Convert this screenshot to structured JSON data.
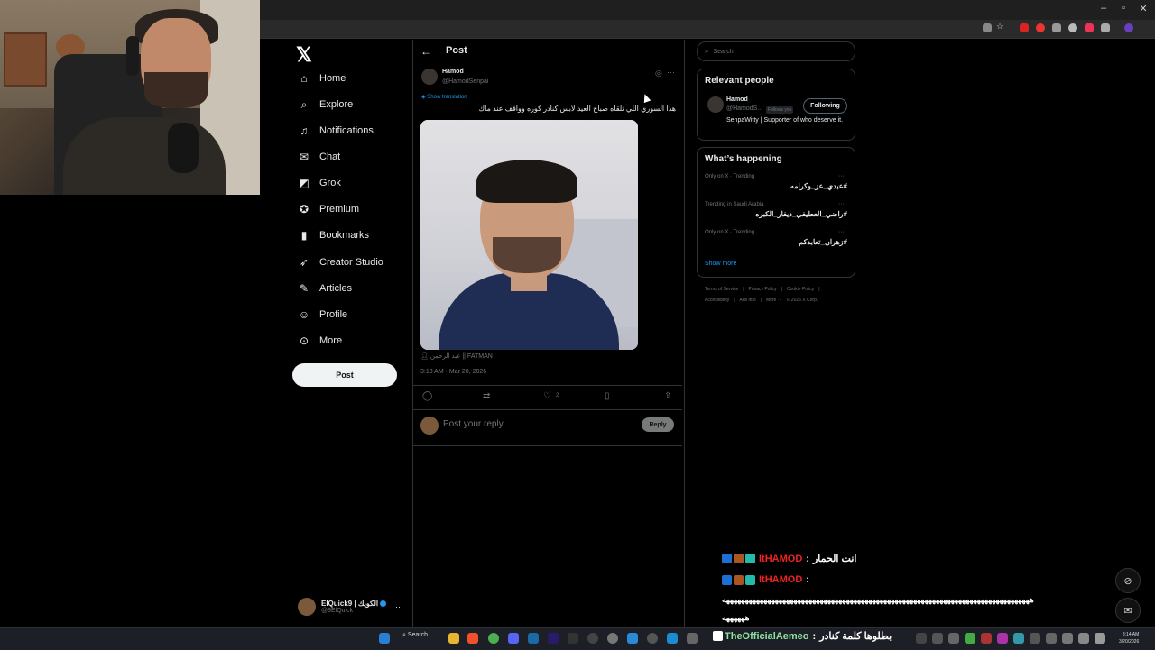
{
  "x_logo": "𝕏",
  "nav": {
    "items": [
      {
        "label": "Home",
        "icon": "home-icon",
        "glyph": "⌂"
      },
      {
        "label": "Explore",
        "icon": "search-icon",
        "glyph": "⌕"
      },
      {
        "label": "Notifications",
        "icon": "bell-icon",
        "glyph": "♫"
      },
      {
        "label": "Chat",
        "icon": "mail-icon",
        "glyph": "✉"
      },
      {
        "label": "Grok",
        "icon": "grok-icon",
        "glyph": "◩"
      },
      {
        "label": "Premium",
        "icon": "premium-icon",
        "glyph": "✪"
      },
      {
        "label": "Bookmarks",
        "icon": "bookmark-icon",
        "glyph": "▮"
      },
      {
        "label": "Creator Studio",
        "icon": "rocket-icon",
        "glyph": "➶"
      },
      {
        "label": "Articles",
        "icon": "articles-icon",
        "glyph": "✎"
      },
      {
        "label": "Profile",
        "icon": "person-icon",
        "glyph": "☺"
      },
      {
        "label": "More",
        "icon": "more-circle-icon",
        "glyph": "⊙"
      }
    ],
    "post_button": "Post"
  },
  "account": {
    "name": "ElQuick9 | الكويك",
    "handle": "@9ElQuick",
    "more": "···"
  },
  "post_header": {
    "back": "←",
    "title": "Post"
  },
  "tweet": {
    "author_name": "Hamod",
    "author_handle": "@HamodSenpai",
    "show_translation": "Show translation",
    "text": "هذا السوري اللي تلقاه صباح العيد لابس كنادر كوره وواقف عند ماك",
    "credit": "عبد الرحمن || FATMAN",
    "timestamp": "3:13 AM · Mar 20, 2026",
    "likes": "2"
  },
  "reply": {
    "placeholder": "Post your reply",
    "button": "Reply"
  },
  "search": {
    "placeholder": "Search"
  },
  "relevant_people": {
    "title": "Relevant people",
    "name": "Hamod",
    "handle": "@HamodS...",
    "follows_you": "Follows you",
    "follow_button": "Following",
    "bio": "SenpaWitty | Supporter of who deserve it."
  },
  "whats_happening": {
    "title": "What’s happening",
    "trends": [
      {
        "meta": "Only on X · Trending",
        "tag": "#عبدي_عز_وكرامه"
      },
      {
        "meta": "Trending in Saudi Arabia",
        "tag": "#راضي_العطيفي_ديفار_الكبره"
      },
      {
        "meta": "Only on X · Trending",
        "tag": "#زهران_تعابدكم"
      }
    ],
    "show_more": "Show more"
  },
  "footer": {
    "row1": [
      "Terms of Service",
      "|",
      "Privacy Policy",
      "|",
      "Cookie Policy",
      "|"
    ],
    "row2": [
      "Accessibility",
      "|",
      "Ads info",
      "|",
      "More ···",
      "© 2026 X Corp."
    ]
  },
  "chat": {
    "lines": [
      {
        "user": "ItHAMOD",
        "sep": ":",
        "msg": "انت الحمار"
      },
      {
        "user": "ItHAMOD",
        "sep": ":",
        "msg": ""
      }
    ],
    "spam_line1": "ههههههههههههههههههههههههههههههههههههههههههههههههههههههههههههههههههههههههههههههههههه",
    "spam_line2": "ههههههه"
  },
  "taskbar": {
    "search": "Search",
    "twitch_user": "TheOfficialAemeo",
    "twitch_sep": ":",
    "twitch_msg": "بطلوها كلمة كنادر",
    "time": "3:14 AM",
    "date": "3/20/2026"
  },
  "colors": {
    "accent": "#1d9bf0",
    "background": "#000000",
    "border": "#2f3336",
    "muted": "#71767b",
    "chat_user": "#ee2222"
  }
}
